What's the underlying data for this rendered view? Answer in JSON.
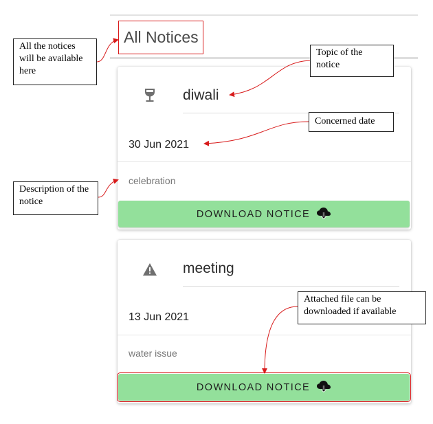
{
  "header": {
    "title": "All Notices"
  },
  "notices": [
    {
      "icon": "wine-glass-icon",
      "topic": "diwali",
      "date": "30 Jun 2021",
      "description": "celebration",
      "download_label": "DOWNLOAD NOTICE"
    },
    {
      "icon": "warning-icon",
      "topic": "meeting",
      "date": "13 Jun 2021",
      "description": "water issue",
      "download_label": "DOWNLOAD NOTICE"
    }
  ],
  "annotations": {
    "all_notices": "All the notices will be available here",
    "topic": "Topic of the notice",
    "date": "Concerned date",
    "description": "Description of the notice",
    "attachment": "Attached file can be downloaded if available"
  },
  "colors": {
    "button_green": "#93e09b",
    "annotation_red": "#d81b1b"
  }
}
